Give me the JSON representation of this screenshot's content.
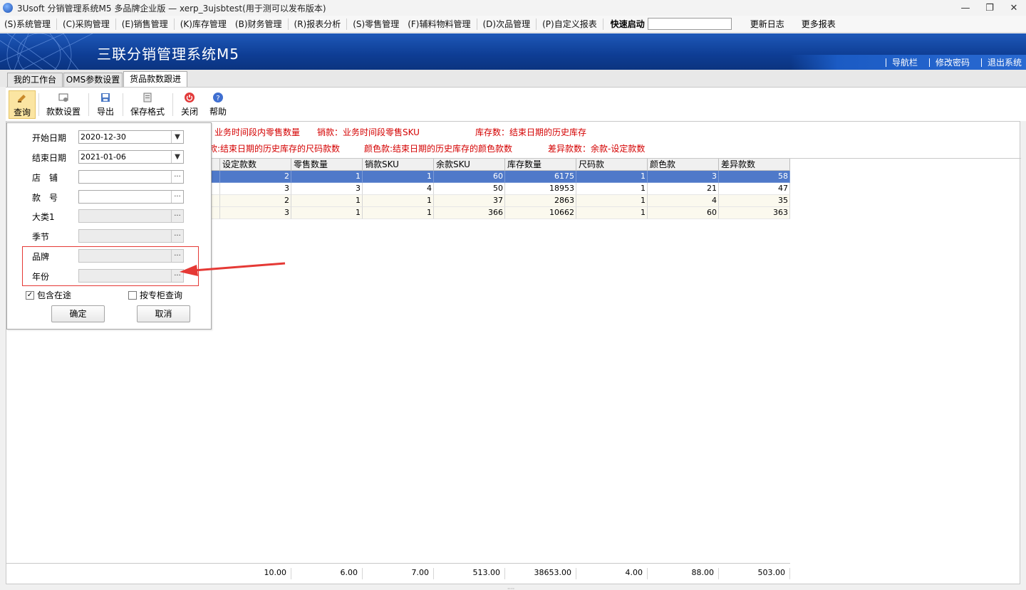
{
  "window": {
    "title": "3Usoft 分销管理系统M5 多品牌企业版 — xerp_3ujsbtest(用于测可以发布版本)",
    "buttons": [
      "—",
      "❐",
      "✕"
    ]
  },
  "menu": {
    "items": [
      "(S)系统管理",
      "(C)采购管理",
      "(E)销售管理",
      "(K)库存管理",
      "(B)财务管理",
      "(R)报表分析",
      "(S)零售管理",
      "(F)辅料物料管理",
      "(D)次品管理",
      "(P)自定义报表"
    ],
    "quick_label": "快速启动",
    "quick_value": "",
    "extra": [
      "更新日志",
      "更多报表"
    ]
  },
  "banner": {
    "brand": "三联分销管理系统M5",
    "links": [
      "导航栏",
      "修改密码",
      "退出系统"
    ]
  },
  "tabs": [
    {
      "label": "我的工作台",
      "active": false
    },
    {
      "label": "OMS参数设置",
      "active": false
    },
    {
      "label": "货品款数跟进",
      "active": true
    }
  ],
  "toolbar": {
    "query": "查询",
    "style_setting": "款数设置",
    "export": "导出",
    "save_format": "保存格式",
    "close": "关闭",
    "help": "帮助"
  },
  "legend": {
    "line1": [
      "业务时间段内零售数量",
      "销款：业务时间段零售SKU",
      "库存数：结束日期的历史库存"
    ],
    "line2": [
      "款:结束日期的历史库存的尺码款数",
      "颜色款:结束日期的历史库存的颜色款数",
      "差异款数：余款-设定款数"
    ]
  },
  "grid": {
    "columns": [
      "设定款数",
      "零售数量",
      "销款SKU",
      "余款SKU",
      "库存数量",
      "尺码款",
      "颜色款",
      "差异款数"
    ],
    "rows": [
      [
        "2",
        "1",
        "1",
        "60",
        "6175",
        "1",
        "3",
        "58"
      ],
      [
        "3",
        "3",
        "4",
        "50",
        "18953",
        "1",
        "21",
        "47"
      ],
      [
        "2",
        "1",
        "1",
        "37",
        "2863",
        "1",
        "4",
        "35"
      ],
      [
        "3",
        "1",
        "1",
        "366",
        "10662",
        "1",
        "60",
        "363"
      ]
    ],
    "totals": [
      "10.00",
      "6.00",
      "7.00",
      "513.00",
      "38653.00",
      "4.00",
      "88.00",
      "503.00"
    ]
  },
  "dialog": {
    "start_date_label": "开始日期",
    "start_date": "2020-12-30",
    "end_date_label": "结束日期",
    "end_date": "2021-01-06",
    "shop_label": "店　铺",
    "style_no_label": "款　号",
    "category_label": "大类1",
    "season_label": "季节",
    "brand_label": "品牌",
    "year_label": "年份",
    "include_transit": "包含在途",
    "by_counter": "按专柜查询",
    "ok": "确定",
    "cancel": "取消",
    "picker": "···"
  },
  "colors": {
    "banner": "#0e3d94",
    "selected_row": "#4f79c9",
    "legend_text": "#d40000",
    "annotation": "#e53935"
  }
}
